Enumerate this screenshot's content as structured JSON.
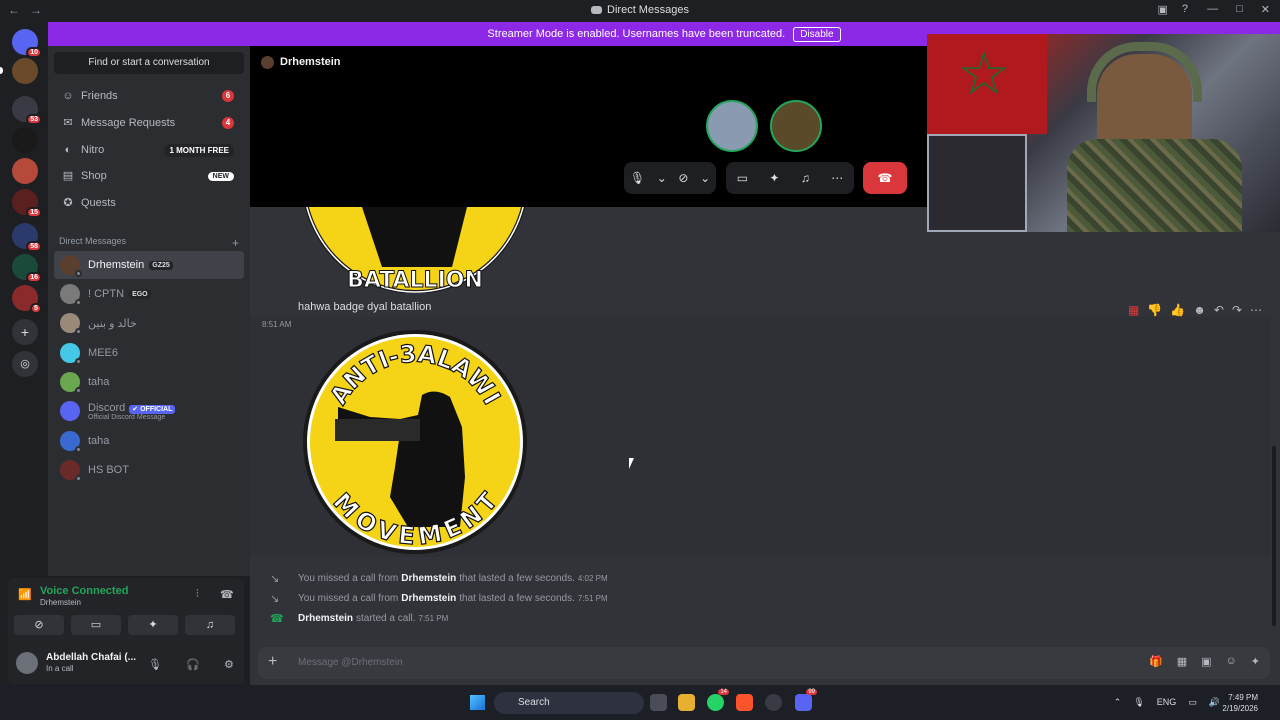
{
  "window": {
    "title": "Direct Messages",
    "back": "←",
    "forward": "→"
  },
  "banner": {
    "text": "Streamer Mode is enabled. Usernames have been truncated.",
    "button": "Disable"
  },
  "servers": [
    {
      "name": "discord-home-icon",
      "badge": "10",
      "color": "#5865f2"
    },
    {
      "name": "server-1",
      "badge": "",
      "color": "#6b4a2b"
    },
    {
      "name": "server-2",
      "badge": "53",
      "color": "#3a3a44"
    },
    {
      "name": "server-3",
      "badge": "",
      "color": "#1a1a1a"
    },
    {
      "name": "server-4",
      "badge": "",
      "color": "#b5493a"
    },
    {
      "name": "server-5",
      "badge": "15",
      "color": "#5a2020"
    },
    {
      "name": "server-6",
      "badge": "58",
      "color": "#2a3a6a"
    },
    {
      "name": "server-7",
      "badge": "16",
      "color": "#1a4a3a"
    },
    {
      "name": "server-8",
      "badge": "5",
      "color": "#8a2a2a"
    }
  ],
  "sidebar": {
    "search": "Find or start a conversation",
    "nav": [
      {
        "label": "Friends",
        "icon": "friends-icon",
        "badge": "6"
      },
      {
        "label": "Message Requests",
        "icon": "mail-icon",
        "badge": "4"
      },
      {
        "label": "Nitro",
        "icon": "nitro-icon",
        "tag": "1 MONTH FREE"
      },
      {
        "label": "Shop",
        "icon": "shop-icon",
        "tag": "NEW"
      },
      {
        "label": "Quests",
        "icon": "quests-icon"
      }
    ],
    "dm_header": "Direct Messages",
    "dms": [
      {
        "name": "Drhemstein",
        "tag": "GZ25",
        "color": "#5a3f2e",
        "active": true
      },
      {
        "name": "! CPTN",
        "tag": "EGO",
        "color": "#7a7a7a"
      },
      {
        "name": "خالد و بنين",
        "color": "#9a8a7a"
      },
      {
        "name": "MEE6",
        "color": "#45c8e8"
      },
      {
        "name": "taha",
        "color": "#6aa84f"
      },
      {
        "name": "Discord",
        "tag": "✔ OFFICIAL",
        "sub": "Official Discord Message",
        "color": "#5865f2"
      },
      {
        "name": "taha",
        "color": "#3a6ad0"
      },
      {
        "name": "HS BOT",
        "color": "#6a2a2a"
      }
    ]
  },
  "voice": {
    "status": "Voice Connected",
    "channel": "Drhemstein",
    "user": "Abdellah Chafai (...",
    "user_state": "In a call"
  },
  "channel": {
    "title": "Drhemstein"
  },
  "call": {
    "participants": [
      {
        "name": "participant-1",
        "color": "#8a9ab0"
      },
      {
        "name": "participant-2",
        "color": "#5a4a2a"
      }
    ]
  },
  "messages": {
    "caption": "hahwa badge dyal batallion",
    "timestamp": "8:51 AM",
    "badge1_text": "BATALLION",
    "badge2_top": "ANTI-3ALAWI",
    "badge2_bottom": "MOVEMENT",
    "system": [
      {
        "pre": "You missed a call from",
        "who": "Drhemstein",
        "post": "that lasted a few seconds.",
        "time": "4:02 PM",
        "green": false
      },
      {
        "pre": "You missed a call from",
        "who": "Drhemstein",
        "post": "that lasted a few seconds.",
        "time": "7:51 PM",
        "green": false
      },
      {
        "pre": "",
        "who": "Drhemstein",
        "post": "started a call.",
        "time": "7:51 PM",
        "green": true
      }
    ]
  },
  "composer": {
    "placeholder": "Message @Drhemstein"
  },
  "taskbar": {
    "search": "Search",
    "lang": "ENG",
    "time": "7:49 PM",
    "date": "2/19/2026",
    "whatsapp_badge": "14",
    "discord_badge": "99"
  }
}
